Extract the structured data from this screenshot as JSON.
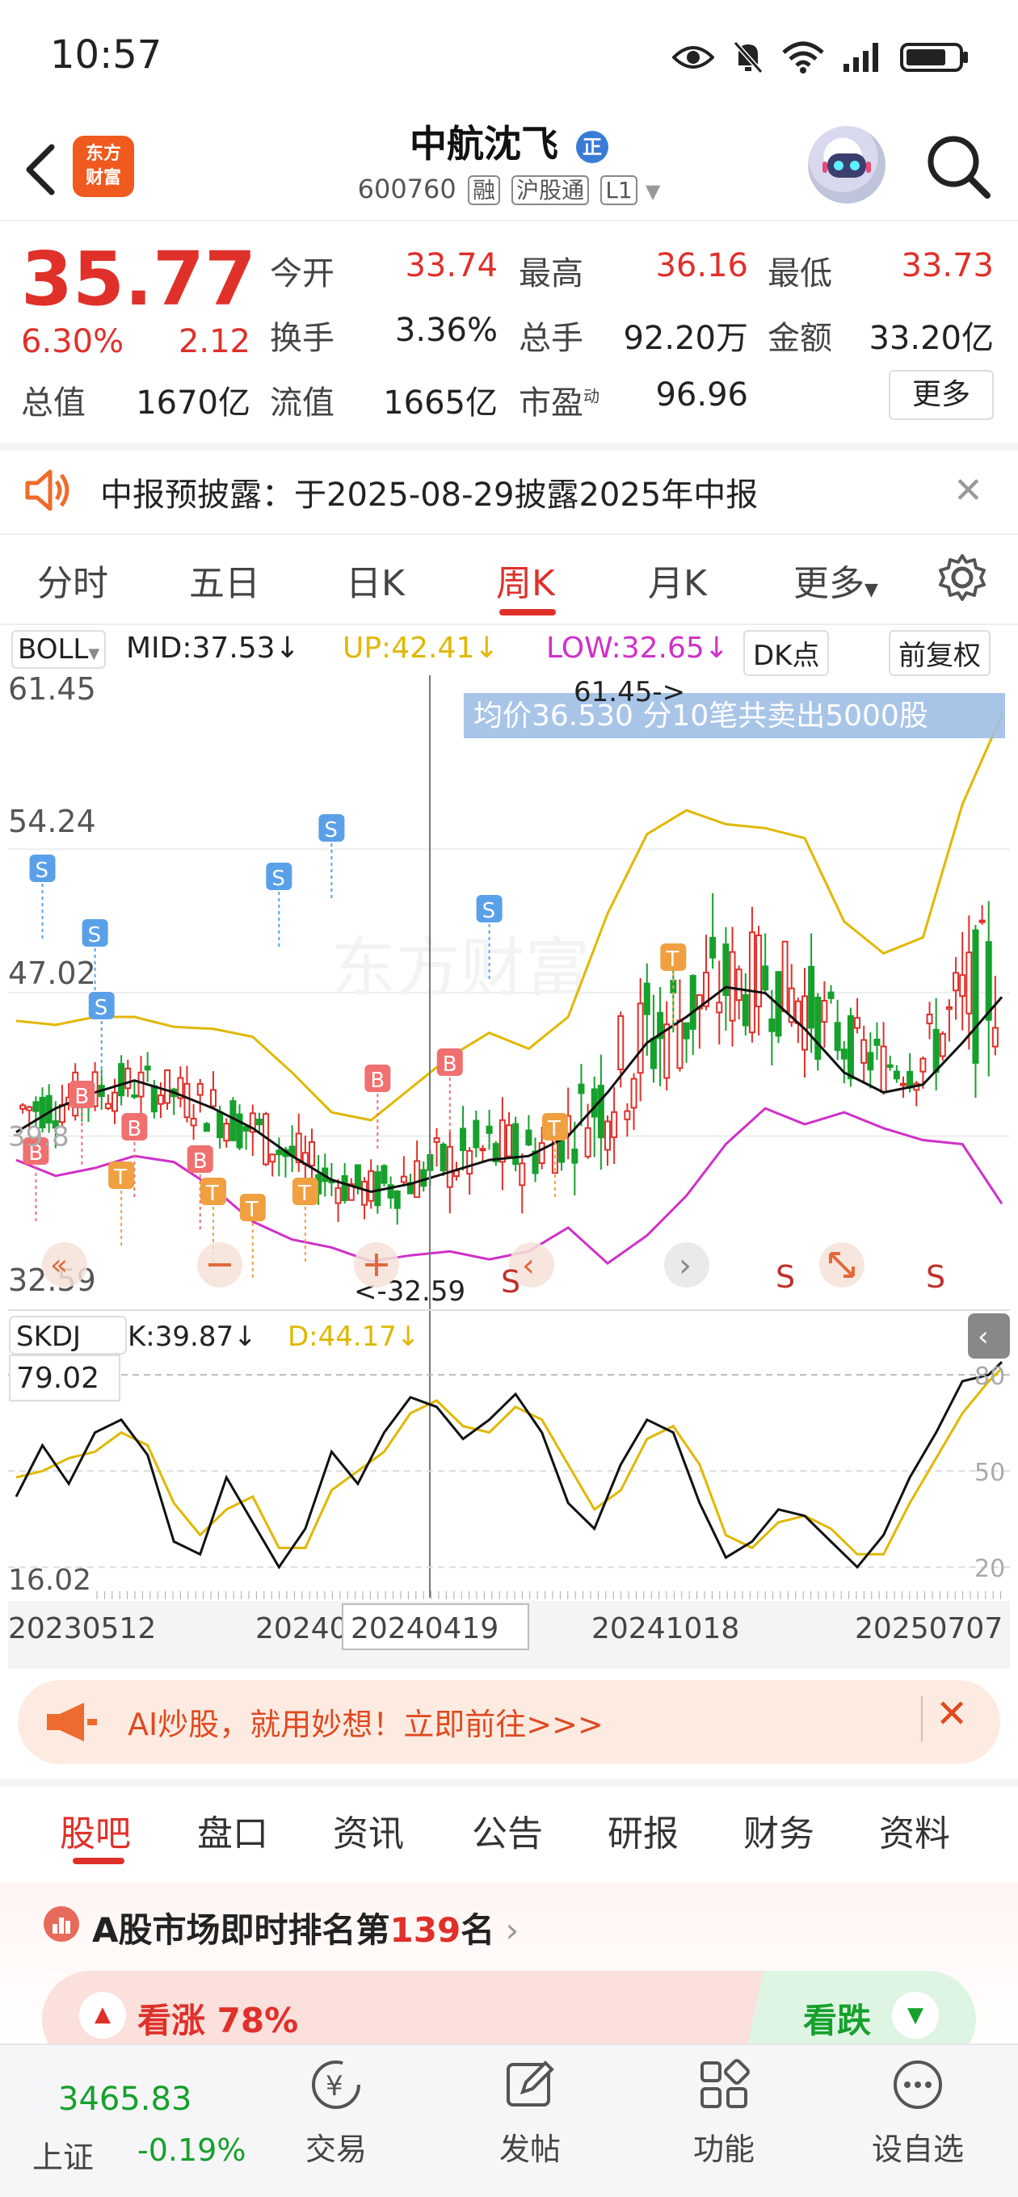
{
  "status_bar": {
    "time": "10:57"
  },
  "header": {
    "logo_text_1": "东方",
    "logo_text_2": "财富",
    "stock_name": "中航沈飞",
    "stock_badge": "正",
    "stock_code": "600760",
    "tags": [
      "融",
      "沪股通",
      "L1"
    ]
  },
  "quote": {
    "price": "35.77",
    "change_pct": "6.30%",
    "change_abs": "2.12",
    "fields": [
      {
        "label": "今开",
        "value": "33.74",
        "color": "#e0302a"
      },
      {
        "label": "最高",
        "value": "36.16",
        "color": "#e0302a"
      },
      {
        "label": "最低",
        "value": "33.73",
        "color": "#e0302a"
      },
      {
        "label": "换手",
        "value": "3.36%",
        "color": "#222222"
      },
      {
        "label": "总手",
        "value": "92.20万",
        "color": "#222222"
      },
      {
        "label": "金额",
        "value": "33.20亿",
        "color": "#222222"
      },
      {
        "label": "总值",
        "value": "1670亿",
        "color": "#222222"
      },
      {
        "label": "流值",
        "value": "1665亿",
        "color": "#222222"
      },
      {
        "label": "市盈",
        "value": "96.96",
        "color": "#222222"
      }
    ],
    "pe_sup": "动",
    "more_label": "更多"
  },
  "notice": {
    "text": "中报预披露：于2025-08-29披露2025年中报"
  },
  "period_tabs": {
    "items": [
      "分时",
      "五日",
      "日K",
      "周K",
      "月K",
      "更多"
    ],
    "active": "周K"
  },
  "boll": {
    "name": "BOLL",
    "mid": "MID:37.53↓",
    "up": "UP:42.41↓",
    "low": "LOW:32.65↓",
    "dk_label": "DK点",
    "adjust_label": "前复权"
  },
  "chart_data": {
    "type": "candlestick",
    "price_axis_labels": [
      "61.45",
      "54.24",
      "47.02",
      "32.59"
    ],
    "extra_axis_label": "39.8",
    "high_marker": "61.45->",
    "low_marker": "<-32.59",
    "tooltip": "均价36.530  分10笔共卖出5000股",
    "date_labels": [
      "20230512",
      "20240",
      "20240419",
      "20241018",
      "20250707"
    ],
    "ylim": [
      32.59,
      61.45
    ],
    "watermark": "东方财富",
    "trade_markers": [
      "S",
      "B",
      "T"
    ],
    "bottom_s_labels": [
      "S",
      "S",
      "S"
    ],
    "colors": {
      "up": "#e0302a",
      "down": "#16a02c",
      "mid": "#111111",
      "upper": "#e0b800",
      "lower": "#d030c8"
    },
    "mid_line": [
      [
        0,
        40.0
      ],
      [
        6,
        41.2
      ],
      [
        12,
        42.0
      ],
      [
        18,
        42.6
      ],
      [
        24,
        42.0
      ],
      [
        30,
        41.2
      ],
      [
        36,
        40.2
      ],
      [
        42,
        38.8
      ],
      [
        48,
        37.6
      ],
      [
        54,
        37.0
      ],
      [
        60,
        37.4
      ],
      [
        66,
        38.0
      ],
      [
        72,
        38.6
      ],
      [
        78,
        38.8
      ],
      [
        84,
        39.8
      ],
      [
        90,
        42.0
      ],
      [
        96,
        44.5
      ],
      [
        102,
        45.8
      ],
      [
        108,
        47.3
      ],
      [
        114,
        47.0
      ],
      [
        120,
        45.2
      ],
      [
        126,
        43.0
      ],
      [
        132,
        42.0
      ],
      [
        138,
        42.4
      ],
      [
        144,
        44.5
      ],
      [
        150,
        46.8
      ]
    ],
    "upper_line": [
      [
        0,
        45.6
      ],
      [
        6,
        45.4
      ],
      [
        12,
        45.8
      ],
      [
        18,
        45.8
      ],
      [
        24,
        45.3
      ],
      [
        30,
        45.2
      ],
      [
        36,
        44.8
      ],
      [
        42,
        43.0
      ],
      [
        48,
        41.0
      ],
      [
        54,
        40.6
      ],
      [
        60,
        42.2
      ],
      [
        66,
        43.8
      ],
      [
        72,
        45.0
      ],
      [
        78,
        44.2
      ],
      [
        84,
        45.8
      ],
      [
        90,
        51.0
      ],
      [
        96,
        55.0
      ],
      [
        102,
        56.2
      ],
      [
        108,
        55.5
      ],
      [
        114,
        55.3
      ],
      [
        120,
        54.8
      ],
      [
        126,
        50.6
      ],
      [
        132,
        49.0
      ],
      [
        138,
        49.8
      ],
      [
        144,
        56.5
      ],
      [
        150,
        61.0
      ]
    ],
    "lower_line": [
      [
        0,
        38.6
      ],
      [
        6,
        37.8
      ],
      [
        12,
        38.2
      ],
      [
        18,
        38.8
      ],
      [
        24,
        38.5
      ],
      [
        30,
        37.2
      ],
      [
        36,
        35.5
      ],
      [
        42,
        34.6
      ],
      [
        48,
        34.2
      ],
      [
        54,
        33.5
      ],
      [
        60,
        33.8
      ],
      [
        66,
        34.0
      ],
      [
        72,
        33.6
      ],
      [
        78,
        34.0
      ],
      [
        84,
        35.2
      ],
      [
        90,
        33.4
      ],
      [
        96,
        34.8
      ],
      [
        102,
        36.8
      ],
      [
        108,
        39.4
      ],
      [
        114,
        41.2
      ],
      [
        120,
        40.4
      ],
      [
        126,
        41.0
      ],
      [
        132,
        40.2
      ],
      [
        138,
        39.6
      ],
      [
        144,
        39.4
      ],
      [
        150,
        36.4
      ]
    ],
    "skdj": {
      "name": "SKDJ",
      "k_label": "K:39.87↓",
      "d_label": "D:44.17↓",
      "ylim": [
        16.02,
        79.02
      ],
      "axis_labels": [
        "79.02",
        "16.02"
      ],
      "right_labels": [
        "80",
        "50",
        "20"
      ],
      "k": [
        [
          0,
          42
        ],
        [
          4,
          58
        ],
        [
          8,
          46
        ],
        [
          12,
          62
        ],
        [
          16,
          66
        ],
        [
          20,
          55
        ],
        [
          24,
          28
        ],
        [
          28,
          24
        ],
        [
          32,
          48
        ],
        [
          36,
          34
        ],
        [
          40,
          20
        ],
        [
          44,
          32
        ],
        [
          48,
          56
        ],
        [
          52,
          46
        ],
        [
          56,
          62
        ],
        [
          60,
          73
        ],
        [
          64,
          70
        ],
        [
          68,
          60
        ],
        [
          72,
          66
        ],
        [
          76,
          74
        ],
        [
          80,
          62
        ],
        [
          84,
          40
        ],
        [
          88,
          32
        ],
        [
          92,
          52
        ],
        [
          96,
          66
        ],
        [
          100,
          62
        ],
        [
          104,
          40
        ],
        [
          108,
          23
        ],
        [
          112,
          28
        ],
        [
          116,
          38
        ],
        [
          120,
          36
        ],
        [
          124,
          28
        ],
        [
          128,
          20
        ],
        [
          132,
          30
        ],
        [
          136,
          48
        ],
        [
          140,
          62
        ],
        [
          144,
          78
        ],
        [
          148,
          80
        ],
        [
          150,
          84
        ]
      ],
      "d": [
        [
          0,
          48
        ],
        [
          4,
          50
        ],
        [
          8,
          54
        ],
        [
          12,
          56
        ],
        [
          16,
          62
        ],
        [
          20,
          58
        ],
        [
          24,
          40
        ],
        [
          28,
          30
        ],
        [
          32,
          38
        ],
        [
          36,
          42
        ],
        [
          40,
          26
        ],
        [
          44,
          26
        ],
        [
          48,
          44
        ],
        [
          52,
          50
        ],
        [
          56,
          56
        ],
        [
          60,
          68
        ],
        [
          64,
          72
        ],
        [
          68,
          64
        ],
        [
          72,
          62
        ],
        [
          76,
          70
        ],
        [
          80,
          66
        ],
        [
          84,
          52
        ],
        [
          88,
          38
        ],
        [
          92,
          44
        ],
        [
          96,
          60
        ],
        [
          100,
          64
        ],
        [
          104,
          52
        ],
        [
          108,
          30
        ],
        [
          112,
          26
        ],
        [
          116,
          34
        ],
        [
          120,
          36
        ],
        [
          124,
          32
        ],
        [
          128,
          24
        ],
        [
          132,
          24
        ],
        [
          136,
          40
        ],
        [
          140,
          54
        ],
        [
          144,
          68
        ],
        [
          148,
          78
        ],
        [
          150,
          82
        ]
      ]
    }
  },
  "ad": {
    "text": "AI炒股，就用妙想！立即前往>>>"
  },
  "lower_tabs": {
    "items": [
      "股吧",
      "盘口",
      "资讯",
      "公告",
      "研报",
      "财务",
      "资料"
    ],
    "active": "股吧"
  },
  "rank": {
    "prefix": "A股市场即时排名第",
    "number": "139",
    "suffix": "名"
  },
  "vote": {
    "up_label": "看涨",
    "up_pct": "78%",
    "down_label": "看跌"
  },
  "bottom_nav": {
    "index_value": "3465.83",
    "index_name": "上证",
    "index_change": "-0.19%",
    "items": [
      "交易",
      "发帖",
      "功能",
      "设自选"
    ]
  }
}
